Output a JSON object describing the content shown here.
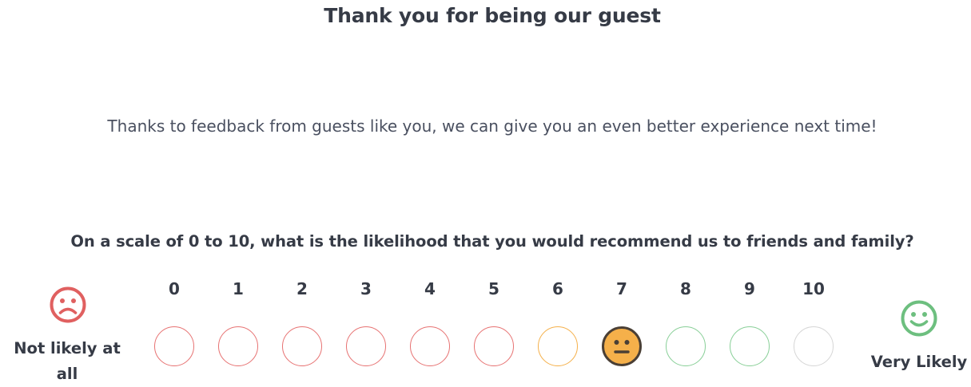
{
  "header": {
    "title": "Thank you for being our guest",
    "subtitle": "Thanks to feedback from guests like you, we can give you an even better experience next time!"
  },
  "survey": {
    "question": "On a scale of 0 to 10, what is the likelihood that you would recommend us to friends and family?",
    "low_label": "Not likely at all",
    "high_label": "Very Likely",
    "selected": 7,
    "scale": [
      {
        "label": "0",
        "color": "#e77272"
      },
      {
        "label": "1",
        "color": "#e77272"
      },
      {
        "label": "2",
        "color": "#e77272"
      },
      {
        "label": "3",
        "color": "#e77272"
      },
      {
        "label": "4",
        "color": "#e77272"
      },
      {
        "label": "5",
        "color": "#e77272"
      },
      {
        "label": "6",
        "color": "#f5b04a"
      },
      {
        "label": "7",
        "color": "#f5b04a"
      },
      {
        "label": "8",
        "color": "#88cf97"
      },
      {
        "label": "9",
        "color": "#88cf97"
      },
      {
        "label": "10",
        "color": "#d6d6d6"
      }
    ]
  },
  "icons": {
    "low": "sad-face-icon",
    "high": "happy-face-icon",
    "selected": "neutral-face-icon"
  },
  "colors": {
    "detractor": "#e77272",
    "passive": "#f5b04a",
    "promoter": "#88cf97",
    "selected_fill": "#f5b04a",
    "selected_border": "#4a3f35"
  }
}
